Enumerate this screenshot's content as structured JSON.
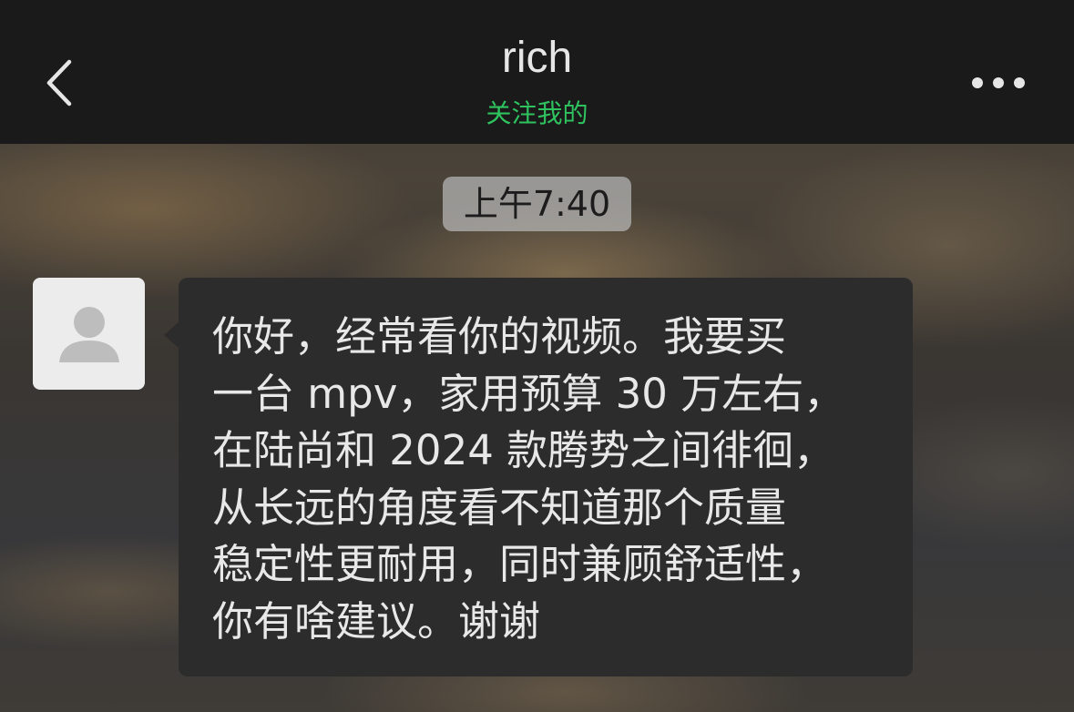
{
  "header": {
    "title": "rich",
    "subtitle": "关注我的",
    "back_icon": "chevron-left-icon",
    "more_icon": "ellipsis-icon"
  },
  "chat": {
    "timestamp": "上午7:40",
    "messages": [
      {
        "sender": "other",
        "avatar_icon": "default-user-avatar-icon",
        "text": "你好，经常看你的视频。我要买\n一台 mpv，家用预算 30 万左右，\n在陆尚和 2024 款腾势之间徘徊，\n从长远的角度看不知道那个质量\n稳定性更耐用，同时兼顾舒适性，\n你有啥建议。谢谢"
      }
    ]
  },
  "colors": {
    "header_bg": "#1a1a1a",
    "subtitle": "#2fc35f",
    "bubble_bg": "#2c2c2c",
    "message_text": "#e8e8e8",
    "timestamp_bg": "#b9b9b9"
  }
}
